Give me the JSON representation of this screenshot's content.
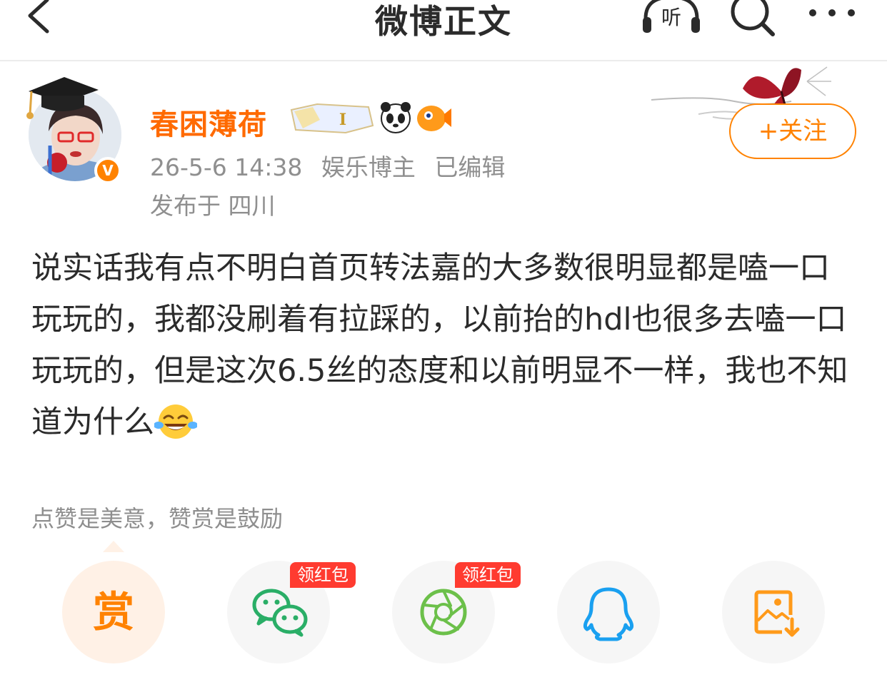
{
  "nav": {
    "title": "微博正文",
    "listen_label": "听"
  },
  "author": {
    "name": "春困薄荷",
    "verified_mark": "V",
    "time": "26-5-6 14:38",
    "role": "娱乐博主",
    "edited": "已编辑",
    "location": "发布于 四川",
    "follow_label": "+关注"
  },
  "post": {
    "text": "说实话我有点不明白首页转法嘉的大多数很明显都是嗑一口玩玩的，我都没刷着有拉踩的，以前抬的hdl也很多去嗑一口玩玩的，但是这次6.5丝的态度和以前明显不一样，我也不知道为什么",
    "emoji": "laugh-cry-emoji"
  },
  "reward": {
    "text": "点赞是美意，赞赏是鼓励",
    "button_label": "赏"
  },
  "share": {
    "items": [
      {
        "name": "reward",
        "icon": "reward-icon"
      },
      {
        "name": "wechat",
        "icon": "wechat-icon",
        "tag": "领红包"
      },
      {
        "name": "moments",
        "icon": "moments-icon",
        "tag": "领红包"
      },
      {
        "name": "qq",
        "icon": "qq-icon"
      },
      {
        "name": "save-image",
        "icon": "save-image-icon"
      }
    ]
  },
  "colors": {
    "accent": "#ff8200",
    "name": "#ff6a00",
    "tag": "#ff3b30",
    "wechat": "#2aae67",
    "moments": "#6cc04a",
    "qq": "#1aa0f0"
  }
}
